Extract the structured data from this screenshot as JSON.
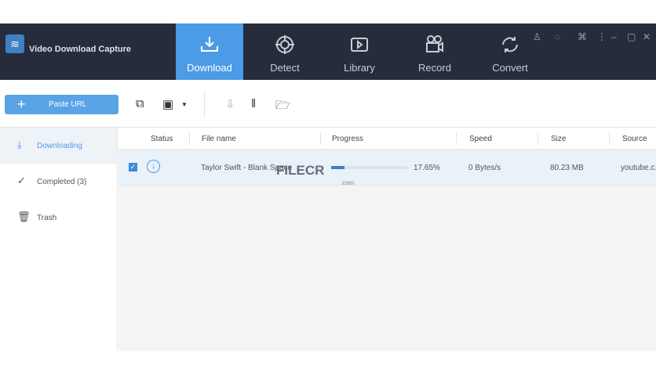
{
  "app": {
    "title": "Video Download Capture"
  },
  "nav": [
    {
      "label": "Download",
      "icon": "download-icon"
    },
    {
      "label": "Detect",
      "icon": "target-icon"
    },
    {
      "label": "Library",
      "icon": "library-icon"
    },
    {
      "label": "Record",
      "icon": "camera-icon"
    },
    {
      "label": "Convert",
      "icon": "convert-icon"
    }
  ],
  "toolbar": {
    "paste_label": "Paste URL"
  },
  "sidebar": [
    {
      "label": "Downloading"
    },
    {
      "label": "Completed (3)"
    },
    {
      "label": "Trash"
    }
  ],
  "table": {
    "headers": [
      "Status",
      "File name",
      "Progress",
      "Speed",
      "Size",
      "Source"
    ],
    "rows": [
      {
        "file": "Taylor Swift - Blank Space",
        "progress_text": "17.65%",
        "progress": 0.1765,
        "speed": "0 Bytes/s",
        "size": "80.23 MB",
        "source": "youtube.c..."
      }
    ]
  },
  "watermark": {
    "text": "FILECR",
    "sub": ".com"
  },
  "colors": {
    "accent": "#4c9be6",
    "topbar": "#262c3b"
  }
}
